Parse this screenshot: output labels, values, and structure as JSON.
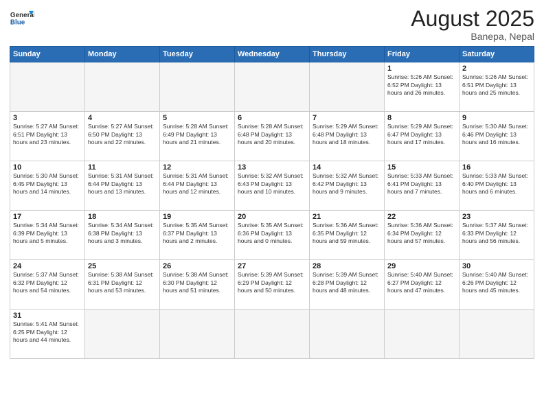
{
  "logo": {
    "general": "General",
    "blue": "Blue"
  },
  "title": "August 2025",
  "subtitle": "Banepa, Nepal",
  "days_header": [
    "Sunday",
    "Monday",
    "Tuesday",
    "Wednesday",
    "Thursday",
    "Friday",
    "Saturday"
  ],
  "weeks": [
    [
      {
        "day": "",
        "info": ""
      },
      {
        "day": "",
        "info": ""
      },
      {
        "day": "",
        "info": ""
      },
      {
        "day": "",
        "info": ""
      },
      {
        "day": "",
        "info": ""
      },
      {
        "day": "1",
        "info": "Sunrise: 5:26 AM\nSunset: 6:52 PM\nDaylight: 13 hours and 26 minutes."
      },
      {
        "day": "2",
        "info": "Sunrise: 5:26 AM\nSunset: 6:51 PM\nDaylight: 13 hours and 25 minutes."
      }
    ],
    [
      {
        "day": "3",
        "info": "Sunrise: 5:27 AM\nSunset: 6:51 PM\nDaylight: 13 hours and 23 minutes."
      },
      {
        "day": "4",
        "info": "Sunrise: 5:27 AM\nSunset: 6:50 PM\nDaylight: 13 hours and 22 minutes."
      },
      {
        "day": "5",
        "info": "Sunrise: 5:28 AM\nSunset: 6:49 PM\nDaylight: 13 hours and 21 minutes."
      },
      {
        "day": "6",
        "info": "Sunrise: 5:28 AM\nSunset: 6:48 PM\nDaylight: 13 hours and 20 minutes."
      },
      {
        "day": "7",
        "info": "Sunrise: 5:29 AM\nSunset: 6:48 PM\nDaylight: 13 hours and 18 minutes."
      },
      {
        "day": "8",
        "info": "Sunrise: 5:29 AM\nSunset: 6:47 PM\nDaylight: 13 hours and 17 minutes."
      },
      {
        "day": "9",
        "info": "Sunrise: 5:30 AM\nSunset: 6:46 PM\nDaylight: 13 hours and 16 minutes."
      }
    ],
    [
      {
        "day": "10",
        "info": "Sunrise: 5:30 AM\nSunset: 6:45 PM\nDaylight: 13 hours and 14 minutes."
      },
      {
        "day": "11",
        "info": "Sunrise: 5:31 AM\nSunset: 6:44 PM\nDaylight: 13 hours and 13 minutes."
      },
      {
        "day": "12",
        "info": "Sunrise: 5:31 AM\nSunset: 6:44 PM\nDaylight: 13 hours and 12 minutes."
      },
      {
        "day": "13",
        "info": "Sunrise: 5:32 AM\nSunset: 6:43 PM\nDaylight: 13 hours and 10 minutes."
      },
      {
        "day": "14",
        "info": "Sunrise: 5:32 AM\nSunset: 6:42 PM\nDaylight: 13 hours and 9 minutes."
      },
      {
        "day": "15",
        "info": "Sunrise: 5:33 AM\nSunset: 6:41 PM\nDaylight: 13 hours and 7 minutes."
      },
      {
        "day": "16",
        "info": "Sunrise: 5:33 AM\nSunset: 6:40 PM\nDaylight: 13 hours and 6 minutes."
      }
    ],
    [
      {
        "day": "17",
        "info": "Sunrise: 5:34 AM\nSunset: 6:39 PM\nDaylight: 13 hours and 5 minutes."
      },
      {
        "day": "18",
        "info": "Sunrise: 5:34 AM\nSunset: 6:38 PM\nDaylight: 13 hours and 3 minutes."
      },
      {
        "day": "19",
        "info": "Sunrise: 5:35 AM\nSunset: 6:37 PM\nDaylight: 13 hours and 2 minutes."
      },
      {
        "day": "20",
        "info": "Sunrise: 5:35 AM\nSunset: 6:36 PM\nDaylight: 13 hours and 0 minutes."
      },
      {
        "day": "21",
        "info": "Sunrise: 5:36 AM\nSunset: 6:35 PM\nDaylight: 12 hours and 59 minutes."
      },
      {
        "day": "22",
        "info": "Sunrise: 5:36 AM\nSunset: 6:34 PM\nDaylight: 12 hours and 57 minutes."
      },
      {
        "day": "23",
        "info": "Sunrise: 5:37 AM\nSunset: 6:33 PM\nDaylight: 12 hours and 56 minutes."
      }
    ],
    [
      {
        "day": "24",
        "info": "Sunrise: 5:37 AM\nSunset: 6:32 PM\nDaylight: 12 hours and 54 minutes."
      },
      {
        "day": "25",
        "info": "Sunrise: 5:38 AM\nSunset: 6:31 PM\nDaylight: 12 hours and 53 minutes."
      },
      {
        "day": "26",
        "info": "Sunrise: 5:38 AM\nSunset: 6:30 PM\nDaylight: 12 hours and 51 minutes."
      },
      {
        "day": "27",
        "info": "Sunrise: 5:39 AM\nSunset: 6:29 PM\nDaylight: 12 hours and 50 minutes."
      },
      {
        "day": "28",
        "info": "Sunrise: 5:39 AM\nSunset: 6:28 PM\nDaylight: 12 hours and 48 minutes."
      },
      {
        "day": "29",
        "info": "Sunrise: 5:40 AM\nSunset: 6:27 PM\nDaylight: 12 hours and 47 minutes."
      },
      {
        "day": "30",
        "info": "Sunrise: 5:40 AM\nSunset: 6:26 PM\nDaylight: 12 hours and 45 minutes."
      }
    ],
    [
      {
        "day": "31",
        "info": "Sunrise: 5:41 AM\nSunset: 6:25 PM\nDaylight: 12 hours and 44 minutes."
      },
      {
        "day": "",
        "info": ""
      },
      {
        "day": "",
        "info": ""
      },
      {
        "day": "",
        "info": ""
      },
      {
        "day": "",
        "info": ""
      },
      {
        "day": "",
        "info": ""
      },
      {
        "day": "",
        "info": ""
      }
    ]
  ]
}
